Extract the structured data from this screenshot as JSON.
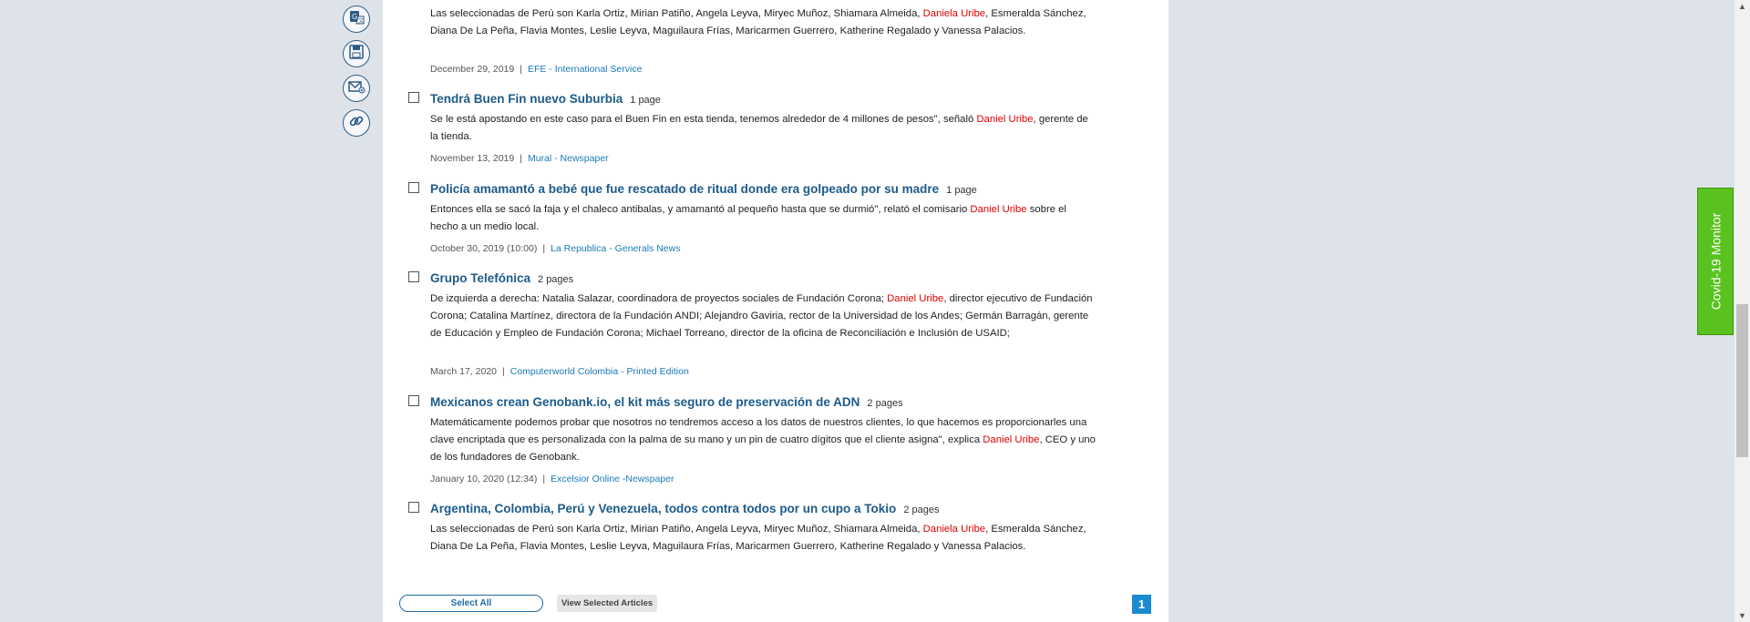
{
  "tools": [
    {
      "name": "translate-icon"
    },
    {
      "name": "save-icon"
    },
    {
      "name": "email-icon"
    },
    {
      "name": "link-icon"
    }
  ],
  "articles": [
    {
      "snippet_parts": [
        "Las seleccionadas de Perú son Karla Ortiz, Mirian Patiño, Angela Leyva, Miryec Muñoz, Shiamara Almeida, ",
        "Daniela Uribe",
        ", Esmeralda Sánchez, Diana De La Peña, Flavia Montes, Leslie Leyva, Maguilaura Frías, Maricarmen Guerrero, Katherine Regalado y Vanessa Palacios."
      ],
      "date": "December 29, 2019",
      "source": "EFE - International Service"
    },
    {
      "title": "Tendrá Buen Fin nuevo Suburbia",
      "pages": "1 page",
      "snippet_parts": [
        "Se le está apostando en este caso para el Buen Fin en esta tienda, tenemos alrededor de 4 millones de pesos\", señaló ",
        "Daniel Uribe",
        ", gerente de la tienda."
      ],
      "date": "November 13, 2019",
      "source": "Mural - Newspaper"
    },
    {
      "title": "Policía amamantó a bebé que fue rescatado de ritual donde era golpeado por su madre",
      "pages": "1 page",
      "snippet_parts": [
        "Entonces ella se sacó la faja y el chaleco antibalas, y amamantó al pequeño hasta que se durmió\", relató el comisario ",
        "Daniel Uribe",
        " sobre el hecho a un medio local."
      ],
      "date": "October 30, 2019 (10:00)",
      "source": "La Republica - Generals News"
    },
    {
      "title": "Grupo Telefónica",
      "pages": "2 pages",
      "snippet_parts": [
        "De izquierda a derecha: Natalia Salazar, coordinadora de proyectos sociales de Fundación Corona; ",
        "Daniel Uribe",
        ", director ejecutivo de Fundación Corona; Catalina Martínez, directora de la Fundación ANDI; Alejandro Gaviria, rector de la Universidad de los Andes; Germán Barragán, gerente de Educación y Empleo de Fundación Corona; Michael Torreano, director de la oficina de Reconciliación e Inclusión de USAID;"
      ],
      "date": "March 17, 2020",
      "source": "Computerworld Colombia - Printed Edition"
    },
    {
      "title": "Mexicanos crean Genobank.io, el kit más seguro de preservación de ADN",
      "pages": "2 pages",
      "snippet_parts": [
        "Matemáticamente podemos probar que nosotros no tendremos acceso a los datos de nuestros clientes, lo que hacemos es proporcionarles una clave encriptada que es personalizada con la palma de su mano y un pin de cuatro dígitos que el cliente asigna\", explica ",
        "Daniel Uribe",
        ", CEO y uno de los fundadores de Genobank."
      ],
      "date": "January 10, 2020 (12:34)",
      "source": "Excelsior Online -Newspaper"
    },
    {
      "title": "Argentina, Colombia, Perú y Venezuela, todos contra todos por un cupo a Tokio",
      "pages": "2 pages",
      "snippet_parts": [
        "Las seleccionadas de Perú son Karla Ortiz, Mirian Patiño, Angela Leyva, Miryec Muñoz, Shiamara Almeida, ",
        "Daniela Uribe",
        ", Esmeralda Sánchez, Diana De La Peña, Flavia Montes, Leslie Leyva, Maguilaura Frías, Maricarmen Guerrero, Katherine Regalado y Vanessa Palacios."
      ]
    }
  ],
  "footer": {
    "select_all": "Select All",
    "view_selected": "View Selected Articles",
    "page": "1"
  },
  "covid_tab": "Covid-19 Monitor",
  "colors": {
    "highlight": "#e00000",
    "title": "#1d5b8a",
    "source": "#1a7ab8",
    "covid": "#5ac21e"
  }
}
